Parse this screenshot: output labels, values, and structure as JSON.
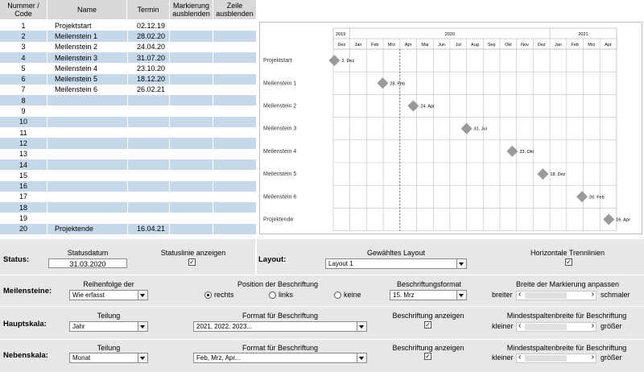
{
  "table": {
    "headers": {
      "number": "Nummer / Code",
      "name": "Name",
      "date": "Termin",
      "hide_marker": "Markierung ausblenden",
      "hide_row": "Zeile ausblenden"
    },
    "rows": [
      {
        "num": "1",
        "name": "Projektstart",
        "date": "02.12.19"
      },
      {
        "num": "2",
        "name": "Meilenstein 1",
        "date": "28.02.20"
      },
      {
        "num": "3",
        "name": "Meilenstein 2",
        "date": "24.04.20"
      },
      {
        "num": "4",
        "name": "Meilenstein 3",
        "date": "31.07.20"
      },
      {
        "num": "5",
        "name": "Meilenstein 4",
        "date": "23.10.20"
      },
      {
        "num": "6",
        "name": "Meilenstein 5",
        "date": "18.12.20"
      },
      {
        "num": "7",
        "name": "Meilenstein 6",
        "date": "26.02.21"
      },
      {
        "num": "8",
        "name": "",
        "date": ""
      },
      {
        "num": "9",
        "name": "",
        "date": ""
      },
      {
        "num": "10",
        "name": "",
        "date": ""
      },
      {
        "num": "11",
        "name": "",
        "date": ""
      },
      {
        "num": "12",
        "name": "",
        "date": ""
      },
      {
        "num": "13",
        "name": "",
        "date": ""
      },
      {
        "num": "14",
        "name": "",
        "date": ""
      },
      {
        "num": "15",
        "name": "",
        "date": ""
      },
      {
        "num": "16",
        "name": "",
        "date": ""
      },
      {
        "num": "17",
        "name": "",
        "date": ""
      },
      {
        "num": "18",
        "name": "",
        "date": ""
      },
      {
        "num": "19",
        "name": "",
        "date": ""
      },
      {
        "num": "20",
        "name": "Projektende",
        "date": "16.04.21"
      }
    ]
  },
  "gantt": {
    "years": [
      "2019",
      "2020",
      "2021"
    ],
    "months": [
      "Dez",
      "Jan",
      "Feb",
      "Mrz",
      "Apr",
      "Mai",
      "Jun",
      "Jul",
      "Aug",
      "Sep",
      "Okt",
      "Nov",
      "Dez",
      "Jan",
      "Feb",
      "Mrz",
      "Apr"
    ],
    "status_month": "Mrz",
    "marker_color": "#9a9a9a",
    "milestones": [
      {
        "label": "Projektstart",
        "caption": "2. Dez"
      },
      {
        "label": "Meilenstein 1",
        "caption": "28. Feb"
      },
      {
        "label": "Meilenstein 2",
        "caption": "24. Apr"
      },
      {
        "label": "Meilenstein 3",
        "caption": "31. Jul"
      },
      {
        "label": "Meilenstein 4",
        "caption": "23. Okt"
      },
      {
        "label": "Meilenstein 5",
        "caption": "18. Dez"
      },
      {
        "label": "Meilenstein 6",
        "caption": "26. Feb"
      },
      {
        "label": "Projektende",
        "caption": "16. Apr"
      }
    ]
  },
  "settings": {
    "status": {
      "label": "Status:",
      "date_label": "Statusdatum",
      "date_value": "31.03.2020",
      "show_line_label": "Statuslinie anzeigen",
      "show_line_checked": "✓"
    },
    "layout": {
      "label": "Layout:",
      "chosen_label": "Gewähltes Layout",
      "chosen_value": "Layout 1",
      "hlines_label": "Horizontale Trennlinien",
      "hlines_checked": "✓"
    },
    "milestones": {
      "label": "Meilensteine:",
      "order_label": "Reihenfolge der Anzeige",
      "order_value": "Wie erfasst",
      "position_label": "Position der Beschriftung",
      "opt_right": "rechts",
      "opt_left": "links",
      "opt_none": "keine",
      "format_label": "Beschriftungsformat",
      "format_value": "15. Mrz",
      "width_label": "Breite der Markierung anpassen",
      "wider": "breiter",
      "narrower": "schmaler"
    },
    "main_scale": {
      "label": "Hauptskala:",
      "division_label": "Teilung",
      "division_value": "Jahr",
      "format_label": "Format für Beschriftung",
      "format_value": "2021, 2022, 2023...",
      "show_label": "Beschriftung anzeigen",
      "show_checked": "✓",
      "min_width_label": "Mindestspaltenbreite für Beschriftung",
      "smaller": "kleiner",
      "larger": "größer"
    },
    "sub_scale": {
      "label": "Nebenskala:",
      "division_label": "Teilung",
      "division_value": "Monat",
      "format_label": "Format für Beschriftung",
      "format_value": "Feb, Mrz, Apr...",
      "show_label": "Beschriftung anzeigen",
      "show_checked": "✓",
      "min_width_label": "Mindestspaltenbreite für Beschriftung",
      "smaller": "kleiner",
      "larger": "größer"
    }
  }
}
